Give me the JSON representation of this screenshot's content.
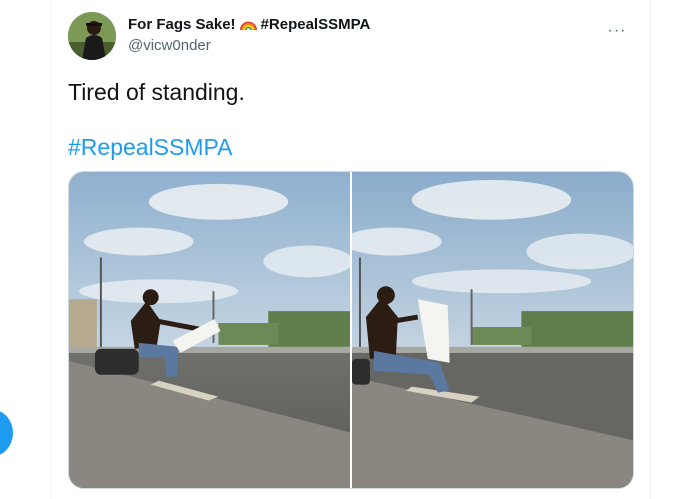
{
  "author": {
    "display_name": "For Fags Sake!",
    "hashtag_in_name": "#RepealSSMPA",
    "handle": "@vicw0nder",
    "avatar": "user-avatar-photo",
    "name_emoji": "rainbow-icon"
  },
  "tweet": {
    "text": "Tired of standing.",
    "hashtag": "#RepealSSMPA",
    "more_icon": "more-options-icon",
    "more_label": "···"
  },
  "media": {
    "photos": [
      {
        "name": "photo-left",
        "description": "man sitting on curb holding paper sign"
      },
      {
        "name": "photo-right",
        "description": "man sitting on curb reading paper sign"
      }
    ]
  },
  "colors": {
    "link": "#1d9bf0",
    "text": "#0f1419",
    "secondary": "#536471",
    "border": "#cfd9de"
  }
}
